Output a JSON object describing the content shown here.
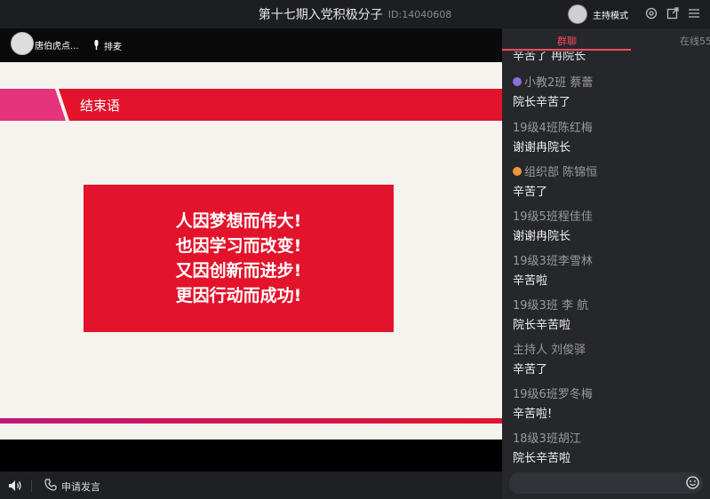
{
  "window": {
    "title": "第十七期入党积极分子",
    "room_id": "ID:14040608",
    "host_mode_label": "主持模式"
  },
  "user_bar": {
    "user_name": "唐伯虎点...",
    "mic_queue_label": "排麦"
  },
  "slide": {
    "section_title": "结束语",
    "lines": [
      "人因梦想而伟大!",
      "也因学习而改变!",
      "又因创新而进步!",
      "更因行动而成功!"
    ],
    "colors": {
      "red": "#e2132b",
      "pink": "#e5337c",
      "background": "#f5f3ee"
    }
  },
  "control_bar": {
    "apply_speak_label": "申请发言"
  },
  "chat": {
    "tabs": {
      "group_chat": "群聊",
      "online": "在线55"
    },
    "partial_top_text": "辛苦了 冉院长",
    "messages": [
      {
        "sender": "小教2班 蔡蕾",
        "text": "院长辛苦了",
        "badge": "purple-user-icon"
      },
      {
        "sender": "19级4班陈红梅",
        "text": "谢谢冉院长"
      },
      {
        "sender": "组织部 陈锦恒",
        "text": "辛苦了",
        "badge": "orange-user-icon"
      },
      {
        "sender": "19级5班程佳佳",
        "text": "谢谢冉院长"
      },
      {
        "sender": "19级3班李雪林",
        "text": "辛苦啦"
      },
      {
        "sender": "19级3班 李 航",
        "text": "院长辛苦啦"
      },
      {
        "sender": "主持人 刘俊驿",
        "text": "辛苦了"
      },
      {
        "sender": "19级6班罗冬梅",
        "text": "辛苦啦!"
      },
      {
        "sender": "18级3班胡江",
        "text": "院长辛苦啦"
      }
    ],
    "accent_color": "#f24c5e"
  }
}
